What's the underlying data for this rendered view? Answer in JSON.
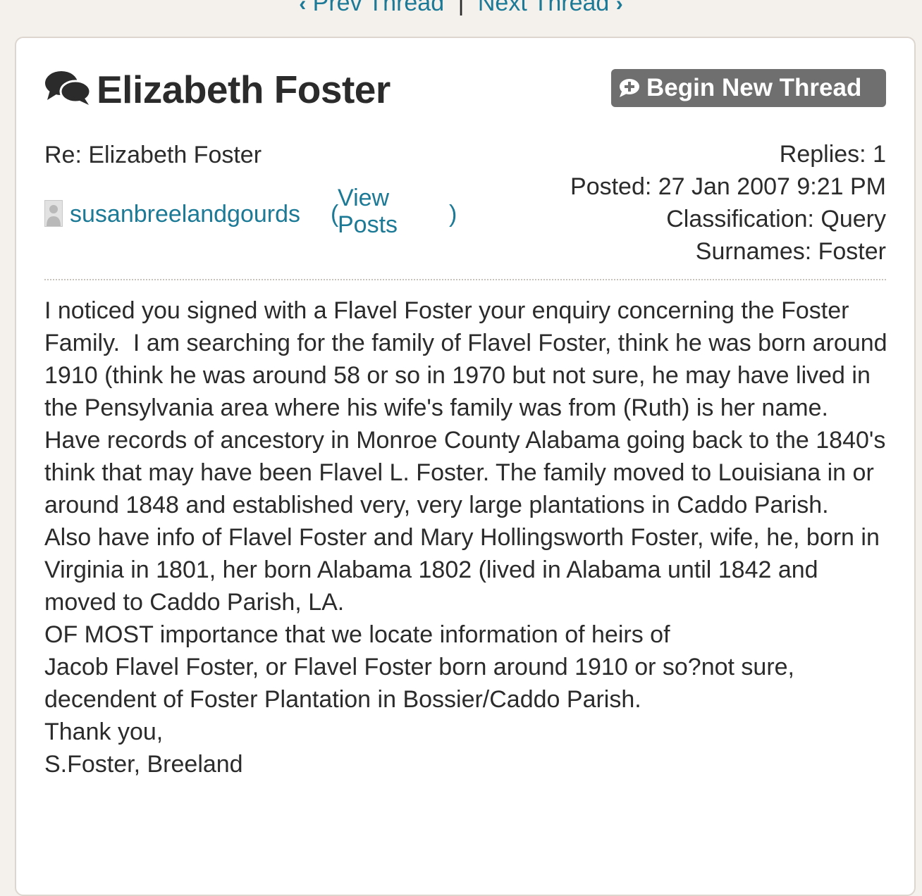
{
  "nav": {
    "prev_label": "Prev Thread",
    "separator": "|",
    "next_label": "Next Thread"
  },
  "thread": {
    "title": "Elizabeth Foster",
    "new_thread_label": "Begin New Thread"
  },
  "post": {
    "subject": "Re: Elizabeth Foster",
    "author": "susanbreelandgourds",
    "paren_open": "(",
    "view_posts_label": "View Posts",
    "paren_close": ")",
    "replies": "Replies: 1",
    "posted": "Posted: 27 Jan 2007 9:21 PM",
    "classification": "Classification: Query",
    "surnames": "Surnames: Foster",
    "body": [
      "I noticed you signed with a Flavel Foster your enquiry concerning the Foster Family.  I am searching for the family of Flavel Foster, think he was born around 1910 (think he was around 58 or so in 1970 but not sure, he may have lived in the Pensylvania area where his wife's family was from (Ruth) is her name.",
      "Have records of ancestory in Monroe County Alabama going back to the 1840's think that may have been Flavel L. Foster. The family moved to Louisiana in or around 1848 and established very, very large plantations in Caddo Parish.",
      "Also have info of Flavel Foster and Mary Hollingsworth Foster, wife, he, born in Virginia in 1801, her born Alabama 1802 (lived in Alabama until 1842 and moved to Caddo Parish, LA.",
      "OF MOST importance that we locate information of heirs of",
      "Jacob Flavel Foster, or Flavel Foster born around 1910 or so?not sure, decendent of Foster Plantation in Bossier/Caddo Parish.",
      "Thank you,",
      "S.Foster, Breeland"
    ]
  },
  "icons": {
    "title": "chat-bubbles-icon",
    "new_thread": "chat-plus-icon",
    "prev": "chevron-left-icon",
    "next": "chevron-right-icon"
  },
  "colors": {
    "link": "#1d7a96",
    "button_bg": "#6f6f6f",
    "page_bg": "#f4f1ed",
    "text": "#2b2b2b"
  }
}
